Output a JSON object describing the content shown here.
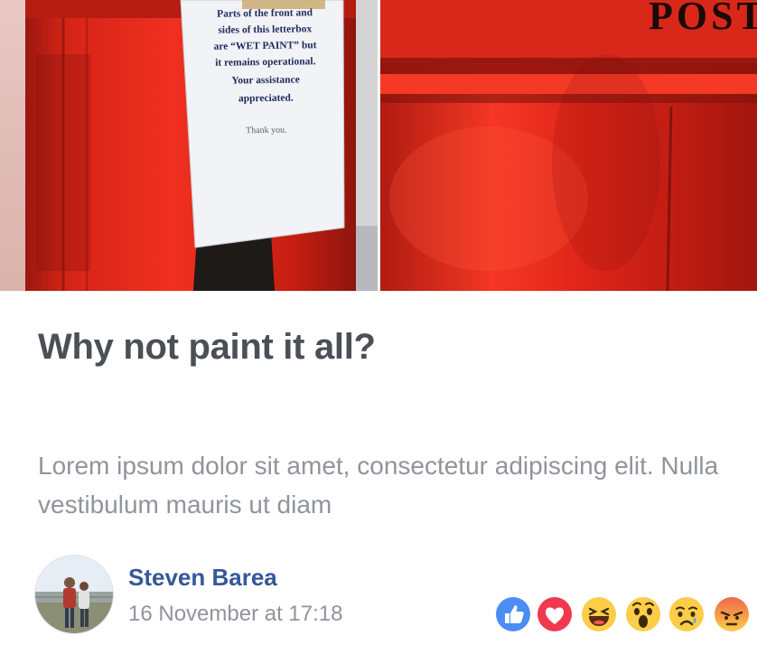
{
  "post": {
    "photos": [
      {
        "subject": "red post box with notice",
        "notice_lines": [
          "Parts of the front and",
          "sides of this letterbox",
          "are “WET PAINT” but",
          "it remains operational.",
          "Your assistance",
          "appreciated.",
          "Thank you."
        ]
      },
      {
        "subject": "red post box close-up",
        "lettering": "POST"
      }
    ],
    "title": "Why not paint it all?",
    "excerpt": "Lorem ipsum dolor sit amet, consectetur adipiscing elit. Nulla vestibulum mauris ut diam"
  },
  "author": {
    "name": "Steven Barea",
    "timestamp": "16 November at 17:18",
    "avatar_icon": "profile-photo"
  },
  "reactions": [
    {
      "name": "like",
      "icon": "thumbs-up-icon",
      "color": "#4b8cf5"
    },
    {
      "name": "love",
      "icon": "heart-icon",
      "color": "#f0384f"
    },
    {
      "name": "haha",
      "icon": "laughing-face-icon",
      "color": "#fbcd48"
    },
    {
      "name": "wow",
      "icon": "surprised-face-icon",
      "color": "#fbcd48"
    },
    {
      "name": "sad",
      "icon": "crying-face-icon",
      "color": "#fbcd48"
    },
    {
      "name": "angry",
      "icon": "angry-face-icon",
      "color": "#f0674a"
    }
  ],
  "colors": {
    "title": "#4b4f56",
    "excerpt": "#90949c",
    "author_link": "#365899",
    "postbox_red": "#e8261a"
  }
}
